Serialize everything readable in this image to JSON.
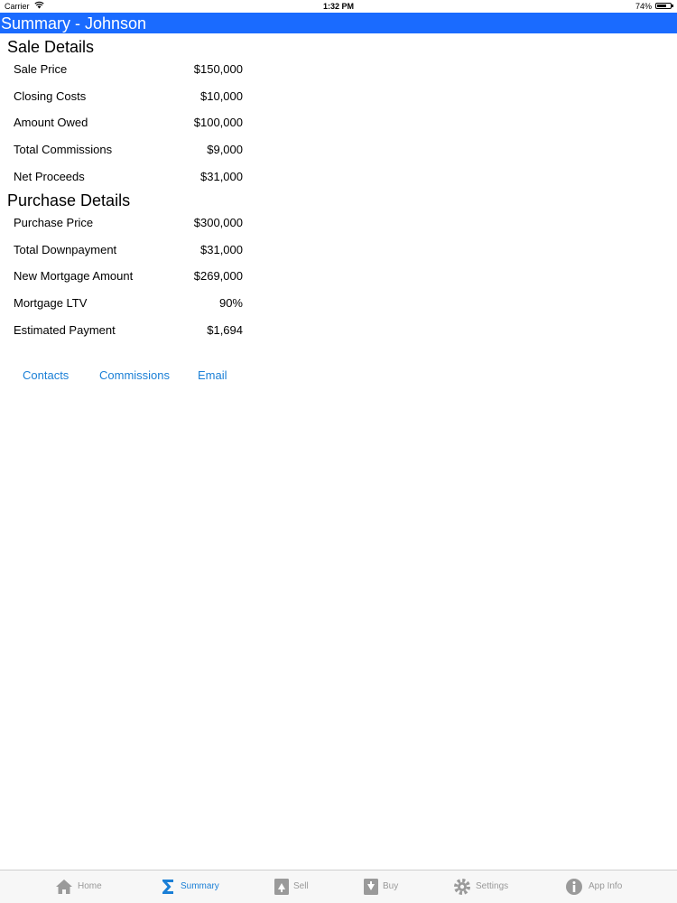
{
  "status_bar": {
    "carrier": "Carrier",
    "time": "1:32 PM",
    "battery": "74%",
    "battery_level": 0.74
  },
  "header": {
    "title": "Summary - Johnson",
    "accent_color": "#1a6bff"
  },
  "sale_details": {
    "heading": "Sale Details",
    "rows": [
      {
        "label": "Sale Price",
        "value": "$150,000"
      },
      {
        "label": "Closing Costs",
        "value": "$10,000"
      },
      {
        "label": "Amount Owed",
        "value": "$100,000"
      },
      {
        "label": "Total Commissions",
        "value": "$9,000"
      },
      {
        "label": "Net Proceeds",
        "value": "$31,000"
      }
    ]
  },
  "purchase_details": {
    "heading": "Purchase Details",
    "rows": [
      {
        "label": "Purchase Price",
        "value": "$300,000"
      },
      {
        "label": "Total Downpayment",
        "value": "$31,000"
      },
      {
        "label": "New Mortgage Amount",
        "value": "$269,000"
      },
      {
        "label": "Mortgage LTV",
        "value": "90%"
      },
      {
        "label": "Estimated Payment",
        "value": "$1,694"
      }
    ]
  },
  "links": {
    "contacts": "Contacts",
    "commissions": "Commissions",
    "email": "Email"
  },
  "tab_bar": {
    "active": "Summary",
    "tabs": [
      {
        "label": "Home",
        "icon": "home-icon"
      },
      {
        "label": "Summary",
        "icon": "sigma-icon"
      },
      {
        "label": "Sell",
        "icon": "sell-icon"
      },
      {
        "label": "Buy",
        "icon": "buy-icon"
      },
      {
        "label": "Settings",
        "icon": "gear-icon"
      },
      {
        "label": "App Info",
        "icon": "info-icon"
      }
    ]
  }
}
